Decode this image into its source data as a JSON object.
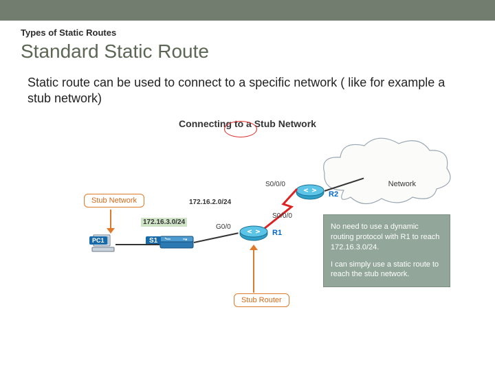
{
  "header": {
    "subtitle": "Types of Static Routes",
    "title": "Standard Static Route"
  },
  "description": "Static route can be used to connect to a specific network ( like for example a stub network)",
  "diagram": {
    "title_prefix": "Connecting ",
    "title_emph": "to a",
    "title_suffix": " Stub Network",
    "cloud_label": "Network",
    "r2": {
      "name": "R2",
      "interface": "S0/0/0"
    },
    "r1": {
      "name": "R1",
      "g0": "G0/0",
      "s0": "S0/0/0"
    },
    "s1": {
      "name": "S1"
    },
    "pc1": {
      "name": "PC1"
    },
    "net_r1_r2": "172.16.2.0/24",
    "net_s1_r1": "172.16.3.0/24",
    "stub_network_pill": "Stub Network",
    "stub_router_pill": "Stub Router",
    "callout_p1": "No need to use a dynamic routing protocol with R1 to reach 172.16.3.0/24.",
    "callout_p2": "I can simply use a static route to reach the stub network."
  }
}
